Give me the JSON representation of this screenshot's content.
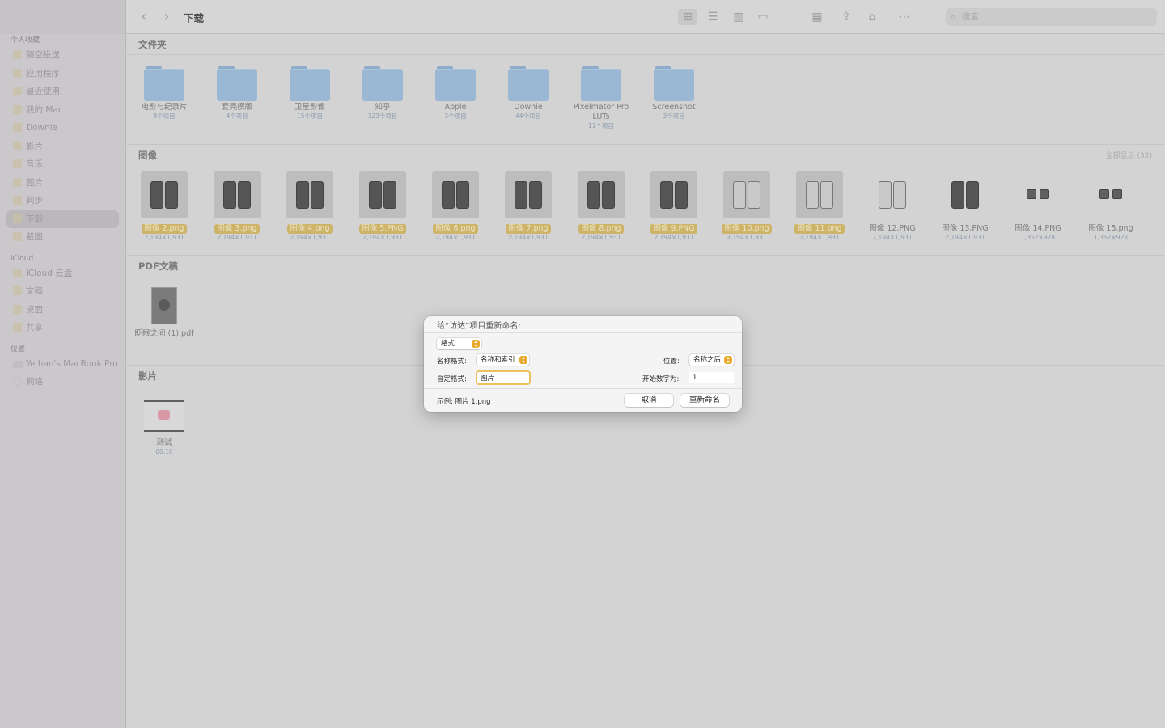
{
  "sidebar": {
    "favorites_header": "个人收藏",
    "favorites": [
      {
        "label": "隔空投送",
        "icon": "airdrop-icon"
      },
      {
        "label": "应用程序",
        "icon": "applications-icon"
      },
      {
        "label": "最近使用",
        "icon": "recents-icon"
      },
      {
        "label": "我的 Mac",
        "icon": "folder-icon"
      },
      {
        "label": "Downie",
        "icon": "folder-icon"
      },
      {
        "label": "影片",
        "icon": "movies-icon"
      },
      {
        "label": "音乐",
        "icon": "music-icon"
      },
      {
        "label": "图片",
        "icon": "pictures-icon"
      },
      {
        "label": "同步",
        "icon": "folder-icon"
      },
      {
        "label": "下载",
        "icon": "downloads-icon"
      },
      {
        "label": "截图",
        "icon": "folder-icon"
      }
    ],
    "icloud_header": "iCloud",
    "icloud": [
      {
        "label": "iCloud 云盘",
        "icon": "icloud-icon"
      },
      {
        "label": "文稿",
        "icon": "documents-icon"
      },
      {
        "label": "桌面",
        "icon": "desktop-icon"
      },
      {
        "label": "共享",
        "icon": "shared-folder-icon"
      }
    ],
    "locations_header": "位置",
    "locations": [
      {
        "label": "Ye han's MacBook Pro",
        "icon": "laptop-icon"
      },
      {
        "label": "网络",
        "icon": "network-icon"
      }
    ]
  },
  "toolbar": {
    "title": "下载",
    "search_placeholder": "搜索",
    "icons": {
      "back": "‹",
      "forward": "›",
      "grid": "⊞",
      "list": "☰",
      "columns": "▥",
      "gallery": "▭",
      "group": "▦",
      "share": "⇪",
      "tag": "⌂",
      "more": "⋯",
      "search": "⌕"
    }
  },
  "sections": {
    "folders": {
      "title": "文件夹",
      "items": [
        {
          "name": "电影与纪录片",
          "sub": "8个项目"
        },
        {
          "name": "套壳模版",
          "sub": "4个项目"
        },
        {
          "name": "卫星影像",
          "sub": "15个项目"
        },
        {
          "name": "知乎",
          "sub": "123个项目"
        },
        {
          "name": "Apple",
          "sub": "3个项目"
        },
        {
          "name": "Downie",
          "sub": "44个项目"
        },
        {
          "name": "Pixelmator Pro LUTs",
          "sub": "11个项目"
        },
        {
          "name": "Screenshot",
          "sub": "3个项目"
        }
      ]
    },
    "images": {
      "title": "图像",
      "show_all": "全部显示 (32)",
      "items": [
        {
          "name": "图像 2.png",
          "sub": "2,194×1,931"
        },
        {
          "name": "图像 3.png",
          "sub": "2,194×1,931"
        },
        {
          "name": "图像 4.png",
          "sub": "2,194×1,931"
        },
        {
          "name": "图像 5.PNG",
          "sub": "2,194×1,931"
        },
        {
          "name": "图像 6.png",
          "sub": "2,194×1,931"
        },
        {
          "name": "图像 7.png",
          "sub": "2,194×1,931"
        },
        {
          "name": "图像 8.png",
          "sub": "2,194×1,931"
        },
        {
          "name": "图像 9.PNG",
          "sub": "2,194×1,931"
        },
        {
          "name": "图像 10.png",
          "sub": "2,194×1,931"
        },
        {
          "name": "图像 11.png",
          "sub": "2,194×1,931"
        },
        {
          "name": "图像 12.PNG",
          "sub": "2,194×1,931"
        },
        {
          "name": "图像 13.PNG",
          "sub": "2,194×1,931"
        },
        {
          "name": "图像 14.PNG",
          "sub": "1,352×928"
        },
        {
          "name": "图像 15.png",
          "sub": "1,352×928"
        }
      ]
    },
    "pdf": {
      "title": "PDF文稿",
      "items": [
        {
          "name": "眨眼之间 (1).pdf"
        }
      ]
    },
    "movies": {
      "title": "影片",
      "items": [
        {
          "name": "测试",
          "sub": "00:10"
        }
      ]
    }
  },
  "dialog": {
    "title": "给“访达”项目重新命名:",
    "format_popup": "格式",
    "name_format_label": "名称格式:",
    "name_format_value": "名称和索引",
    "position_label": "位置:",
    "position_value": "名称之后",
    "custom_format_label": "自定格式:",
    "custom_format_value": "图片",
    "start_number_label": "开始数字为:",
    "start_number_value": "1",
    "example": "示例: 图片 1.png",
    "cancel": "取消",
    "rename": "重新命名"
  },
  "colors": {
    "selection": "#cdb468",
    "folder": "#9ab7d3",
    "accent": "#e9a92c"
  }
}
